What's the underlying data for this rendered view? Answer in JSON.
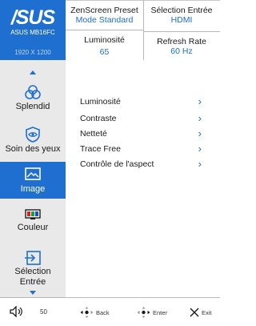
{
  "header": {
    "brand": "/SUS",
    "model": "ASUS MB16FC",
    "resolution": "1920 X 1200"
  },
  "info": {
    "preset_label": "ZenScreen Preset",
    "preset_value": "Mode Standard",
    "input_label": "Sélection Entrée",
    "input_value": "HDMI",
    "brightness_label": "Luminosité",
    "brightness_value": "65",
    "refresh_label": "Refresh Rate",
    "refresh_value": "60 Hz"
  },
  "sidebar": {
    "items": [
      {
        "label": "Splendid",
        "icon": "splendid-icon"
      },
      {
        "label": "Soin des yeux",
        "icon": "eye-care-icon"
      },
      {
        "label": "Image",
        "icon": "image-icon",
        "active": true
      },
      {
        "label": "Couleur",
        "icon": "color-icon"
      },
      {
        "label": "Sélection Entrée",
        "icon": "input-select-icon"
      }
    ]
  },
  "menu": {
    "items": [
      {
        "label": "Luminosité"
      },
      {
        "label": "Contraste"
      },
      {
        "label": "Netteté"
      },
      {
        "label": "Trace Free"
      },
      {
        "label": "Contrôle de l'aspect"
      }
    ]
  },
  "footer": {
    "volume_value": "50",
    "back_label": "Back",
    "enter_label": "Enter",
    "exit_label": "Exit"
  },
  "colors": {
    "accent": "#1f6fd1",
    "sidebar_bg": "#e9e9e9"
  }
}
